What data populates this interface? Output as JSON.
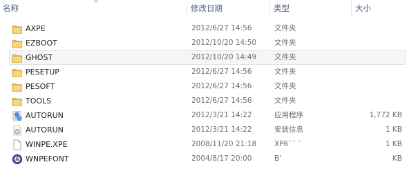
{
  "columns": {
    "name": "名称",
    "modified": "修改日期",
    "type": "类型",
    "size": "大小"
  },
  "files": [
    {
      "name": "AXPE",
      "modified": "2012/6/27 14:56",
      "type": "文件夹",
      "size": "",
      "icon": "folder-icon"
    },
    {
      "name": "EZBOOT",
      "modified": "2012/10/20 14:50",
      "type": "文件夹",
      "size": "",
      "icon": "folder-icon"
    },
    {
      "name": "GHOST",
      "modified": "2012/10/20 14:49",
      "type": "文件夹",
      "size": "",
      "icon": "folder-icon",
      "hovered": true
    },
    {
      "name": "PESETUP",
      "modified": "2012/6/27 14:56",
      "type": "文件夹",
      "size": "",
      "icon": "folder-icon"
    },
    {
      "name": "PESOFT",
      "modified": "2012/6/27 14:56",
      "type": "文件夹",
      "size": "",
      "icon": "folder-icon"
    },
    {
      "name": "TOOLS",
      "modified": "2012/6/27 14:56",
      "type": "文件夹",
      "size": "",
      "icon": "folder-icon"
    },
    {
      "name": "AUTORUN",
      "modified": "2012/3/21 14:22",
      "type": "应用程序",
      "size": "1,772 KB",
      "icon": "application-icon"
    },
    {
      "name": "AUTORUN",
      "modified": "2012/3/21 14:22",
      "type": "安装信息",
      "size": "1 KB",
      "icon": "setup-info-icon"
    },
    {
      "name": "WINPE.XPE",
      "modified": "2008/11/20 21:18",
      "type": "XP6`` `",
      "size": "1 KB",
      "icon": "file-icon"
    },
    {
      "name": "WNPEFONT",
      "modified": "2004/8/17 20:00",
      "type": "B'",
      "size": "KB",
      "icon": "font-file-icon"
    }
  ]
}
